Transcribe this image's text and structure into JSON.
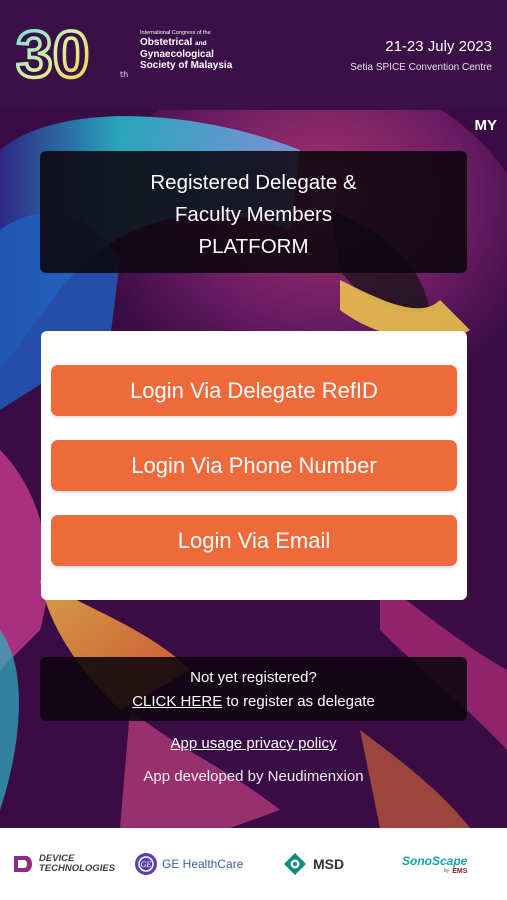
{
  "header": {
    "logo_number": "30",
    "logo_suffix": "th",
    "logo_line1": "International Congress of the",
    "logo_line2_a": "Obstetrical",
    "logo_line2_b": "and",
    "logo_line3": "Gynaecological",
    "logo_line4": "Society of Malaysia",
    "date": "21-23 July 2023",
    "venue": "Setia SPICE Convention Centre"
  },
  "language": "MY",
  "title": {
    "line1": "Registered Delegate &",
    "line2": "Faculty Members",
    "line3": "PLATFORM"
  },
  "login": {
    "refid_label": "Login Via Delegate RefID",
    "phone_label": "Login Via Phone Number",
    "email_label": "Login Via Email"
  },
  "register": {
    "prompt": "Not yet registered?",
    "link_label": "CLICK HERE",
    "suffix": " to register as delegate"
  },
  "footer": {
    "privacy_label": "App usage privacy policy",
    "developer": "App developed by Neudimenxion"
  },
  "sponsors": {
    "device_line1": "DEVICE",
    "device_line2": "TECHNOLOGIES",
    "ge": "GE HealthCare",
    "msd": "MSD",
    "sonoscape": "SonoScape",
    "sonoscape_by": "by",
    "ems": "EMS"
  },
  "colors": {
    "background": "#3a0f45",
    "button": "#ef6a3b",
    "card": "#ffffff",
    "panel": "#0c060e"
  }
}
